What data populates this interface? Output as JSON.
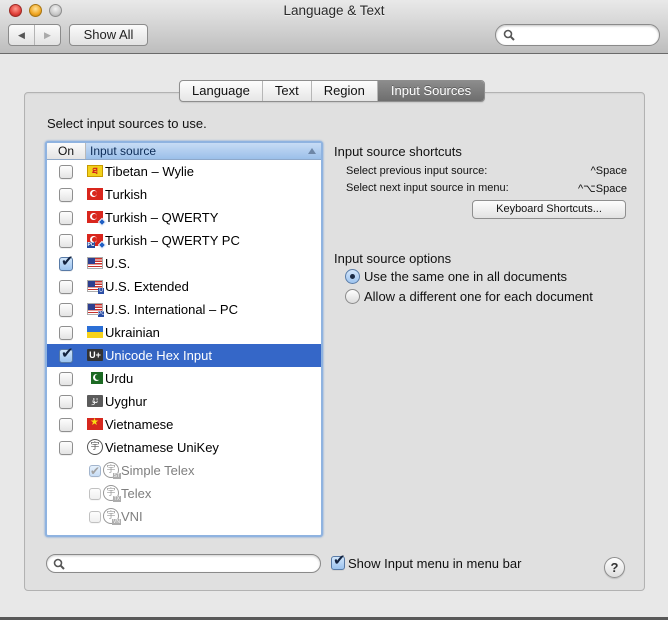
{
  "window": {
    "title": "Language & Text",
    "back_glyph": "◀",
    "forward_glyph": "▶",
    "show_all_label": "Show All",
    "search_placeholder": ""
  },
  "tabs": [
    {
      "label": "Language",
      "active": false
    },
    {
      "label": "Text",
      "active": false
    },
    {
      "label": "Region",
      "active": false
    },
    {
      "label": "Input Sources",
      "active": true
    }
  ],
  "list": {
    "instruction": "Select input sources to use.",
    "header_on": "On",
    "header_source": "Input source",
    "items": [
      {
        "label": "Tibetan – Wylie",
        "checked": false,
        "icon": "tibetan-icon",
        "glyph": "ཐ"
      },
      {
        "label": "Turkish",
        "checked": false,
        "icon": "turkish-flag-icon"
      },
      {
        "label": "Turkish – QWERTY",
        "checked": false,
        "icon": "turkish-qwerty-flag-icon"
      },
      {
        "label": "Turkish – QWERTY PC",
        "checked": false,
        "icon": "turkish-qwerty-pc-flag-icon"
      },
      {
        "label": "U.S.",
        "checked": true,
        "icon": "us-flag-icon"
      },
      {
        "label": "U.S. Extended",
        "checked": false,
        "icon": "us-extended-flag-icon"
      },
      {
        "label": "U.S. International – PC",
        "checked": false,
        "icon": "us-international-pc-flag-icon"
      },
      {
        "label": "Ukrainian",
        "checked": false,
        "icon": "ukraine-flag-icon"
      },
      {
        "label": "Unicode Hex Input",
        "checked": true,
        "selected": true,
        "icon": "unicode-hex-icon",
        "glyph": "U+"
      },
      {
        "label": "Urdu",
        "checked": false,
        "icon": "pakistan-flag-icon"
      },
      {
        "label": "Uyghur",
        "checked": false,
        "icon": "uyghur-icon",
        "glyph": "ئۇ"
      },
      {
        "label": "Vietnamese",
        "checked": false,
        "icon": "vietnam-flag-icon"
      },
      {
        "label": "Vietnamese UniKey",
        "checked": false,
        "icon": "unikey-icon",
        "glyph": "宇"
      },
      {
        "label": "Simple Telex",
        "checked": true,
        "disabled": true,
        "icon": "unikey-simple-telex-icon",
        "badge": "ST"
      },
      {
        "label": "Telex",
        "checked": false,
        "disabled": true,
        "icon": "unikey-telex-icon",
        "badge": "TX"
      },
      {
        "label": "VNI",
        "checked": false,
        "disabled": true,
        "icon": "unikey-vni-icon",
        "badge": "VN"
      }
    ]
  },
  "shortcuts": {
    "heading": "Input source shortcuts",
    "rows": [
      {
        "label": "Select previous input source:",
        "keys": "^Space"
      },
      {
        "label": "Select next input source in menu:",
        "keys": "^⌥Space"
      }
    ],
    "button_label": "Keyboard Shortcuts..."
  },
  "options": {
    "heading": "Input source options",
    "radios": [
      {
        "label": "Use the same one in all documents",
        "selected": true
      },
      {
        "label": "Allow a different one for each document",
        "selected": false
      }
    ]
  },
  "bottom": {
    "search_placeholder": "",
    "show_menu_label": "Show Input menu in menu bar",
    "show_menu_checked": true,
    "help_glyph": "?"
  },
  "colors": {
    "selection": "#3567c8",
    "header_blue": "#9bbfe9"
  }
}
